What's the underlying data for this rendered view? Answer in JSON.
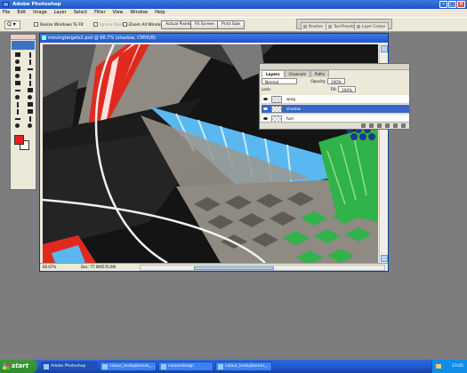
{
  "app": {
    "title": "Adobe Photoshop"
  },
  "menu": [
    "File",
    "Edit",
    "Image",
    "Layer",
    "Select",
    "Filter",
    "View",
    "Window",
    "Help"
  ],
  "options_bar": {
    "zoom_tool": "Q",
    "resize_windows": "Resize Windows To Fit",
    "ignore_palettes": "Ignore Palettes",
    "zoom_all_windows": "Zoom All Windows",
    "actual_pixels": "Actual Pixels",
    "fit_screen": "Fit Screen",
    "print_size": "Print Size"
  },
  "palette_well": {
    "tabs": [
      "Brushes",
      "Tool Presets",
      "Layer Comps"
    ]
  },
  "document": {
    "title": "movingtargets2.psd @ 66.7% (shadow, CMYK/8)",
    "zoom": "66.67%",
    "doc_info": "Doc: 77.0M/576.6M",
    "colors": {
      "red": "#e02a20",
      "blue": "#5ab8f0",
      "green": "#2fb34a",
      "grey": "#8f8a82"
    }
  },
  "layers_panel": {
    "tabs": [
      "Layers",
      "Channels",
      "Paths"
    ],
    "blend_mode": "Normal",
    "opacity_label": "Opacity:",
    "opacity_value": "100%",
    "lock_label": "Lock:",
    "fill_label": "Fill:",
    "fill_value": "100%",
    "layers": [
      {
        "name": "wing",
        "active": false
      },
      {
        "name": "shadow",
        "active": true
      },
      {
        "name": "fuel",
        "active": false
      }
    ]
  },
  "taskbar": {
    "start": "start",
    "tasks": [
      "Adobe Photoshop",
      "colour_lesleybarnes_...",
      "colourdesign",
      "colour_lesleybarnes_..."
    ],
    "clock": "23:05"
  }
}
